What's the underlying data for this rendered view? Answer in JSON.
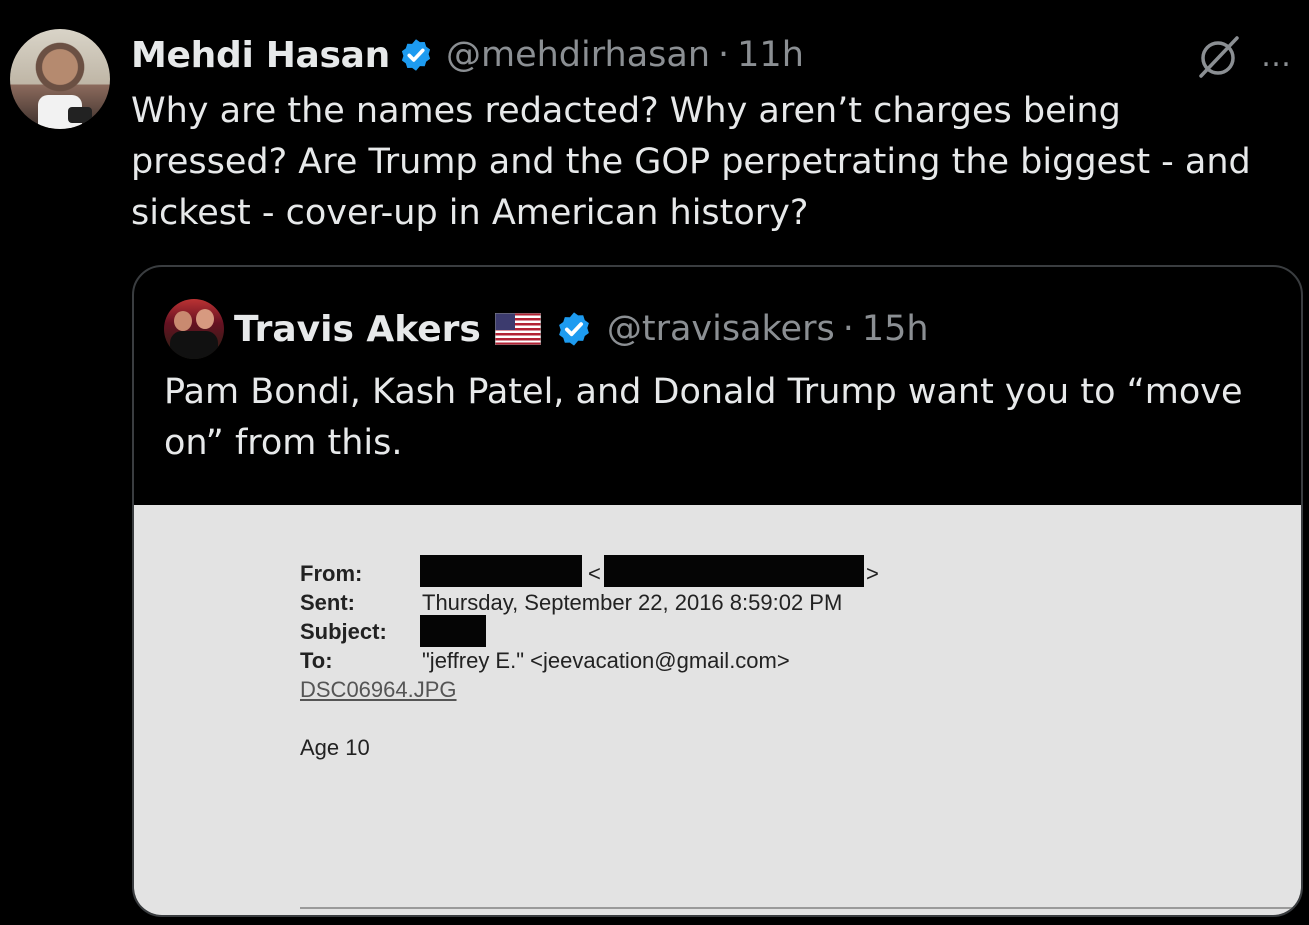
{
  "tweet": {
    "author_name": "Mehdi Hasan",
    "author_handle": "@mehdirhasan",
    "time_sep": "·",
    "time": "11h",
    "text": "Why are the names redacted? Why aren’t charges being pressed? Are Trump and the GOP perpetrating the biggest - and sickest - cover-up in American history?",
    "more_icon": "…"
  },
  "quote": {
    "author_name": "Travis Akers",
    "author_handle": "@travisakers",
    "time_sep": "·",
    "time": "15h",
    "text": "Pam Bondi, Kash Patel, and Donald Trump want you to “move on” from this.",
    "document": {
      "from_label": "From:",
      "from_lt": "<",
      "from_gt": ">",
      "sent_label": "Sent:",
      "sent_value": "Thursday, September 22, 2016 8:59:02 PM",
      "subject_label": "Subject:",
      "to_label": "To:",
      "to_value": "\"jeffrey E.\" <jeevacation@gmail.com>",
      "attachment": "DSC06964.JPG",
      "body": "Age 10"
    }
  },
  "colors": {
    "background": "#000000",
    "text": "#e7e9ea",
    "muted": "#8b8f93",
    "verified": "#1d9bf0",
    "card_border": "#3a3d40",
    "document_bg": "#e3e3e3"
  },
  "icons": [
    "verified-badge-icon",
    "grok-icon",
    "more-icon",
    "us-flag-icon"
  ]
}
